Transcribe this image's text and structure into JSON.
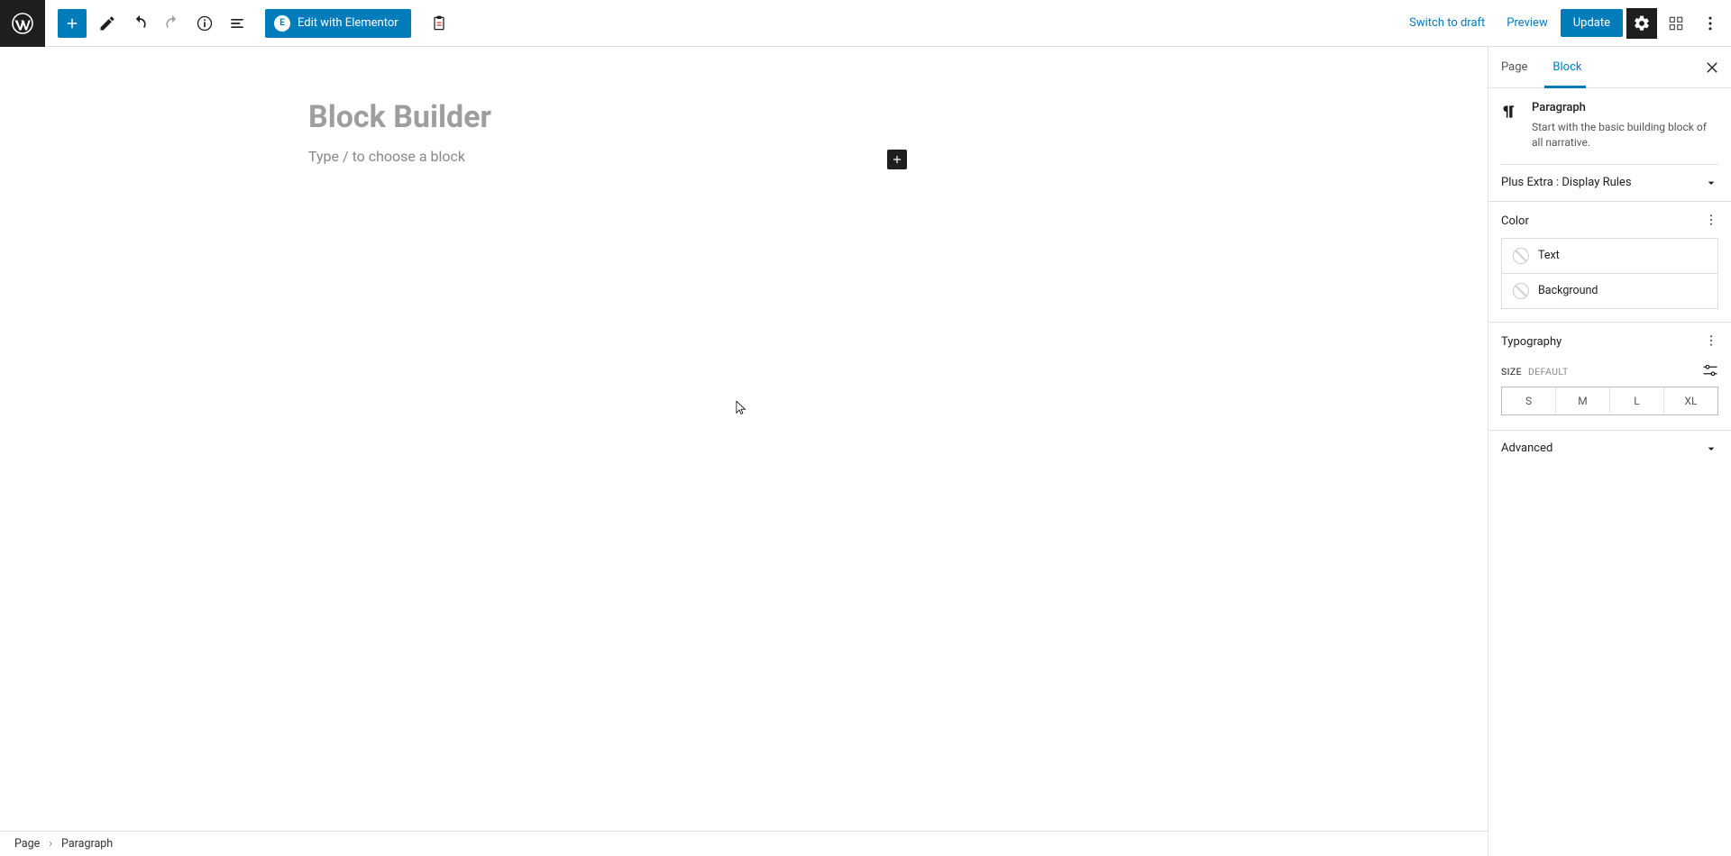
{
  "toolbar": {
    "elementor_label": "Edit with Elementor",
    "switch_draft": "Switch to draft",
    "preview": "Preview",
    "update": "Update"
  },
  "editor": {
    "title": "Block Builder",
    "placeholder": "Type / to choose a block"
  },
  "sidebar": {
    "tabs": {
      "page": "Page",
      "block": "Block"
    },
    "block_name": "Paragraph",
    "block_description": "Start with the basic building block of all narrative.",
    "panels": {
      "display_rules": "Plus Extra : Display Rules",
      "color": "Color",
      "typography": "Typography",
      "advanced": "Advanced"
    },
    "color_items": {
      "text": "Text",
      "background": "Background"
    },
    "typography": {
      "size_label": "SIZE",
      "size_default": "DEFAULT",
      "options": {
        "s": "S",
        "m": "M",
        "l": "L",
        "xl": "XL"
      }
    }
  },
  "breadcrumb": {
    "root": "Page",
    "current": "Paragraph"
  }
}
